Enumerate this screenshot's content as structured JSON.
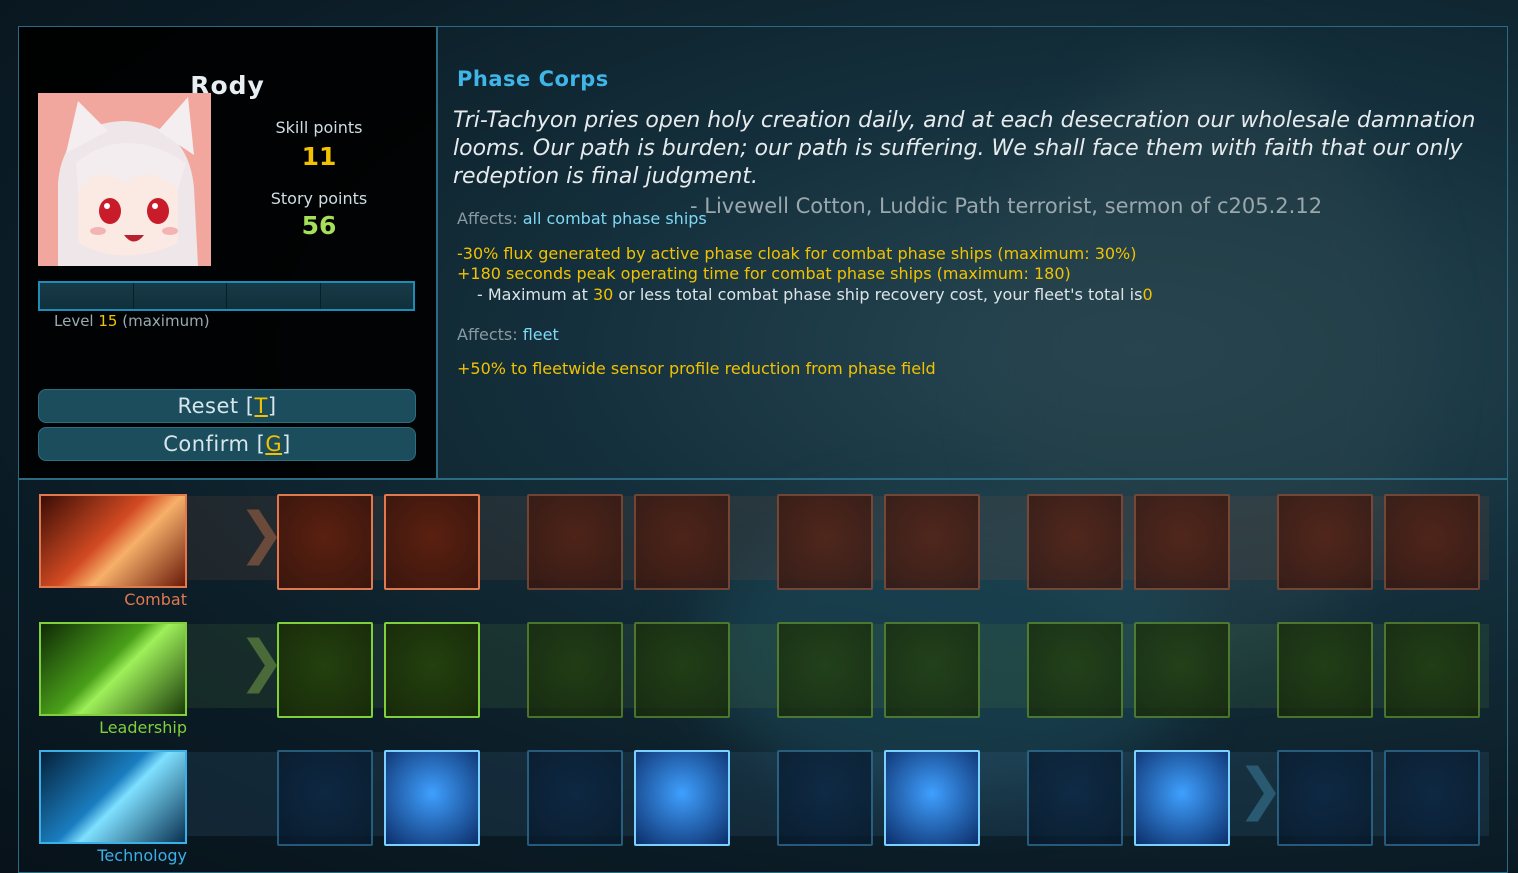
{
  "character": {
    "name": "Rody",
    "skill_points_label": "Skill points",
    "skill_points": "11",
    "story_points_label": "Story points",
    "story_points": "56",
    "level_label": "Level",
    "level_value": "15",
    "level_suffix": "(maximum)",
    "xp_fraction": 1.0
  },
  "buttons": {
    "reset_text": "Reset [",
    "reset_key": "T",
    "confirm_text": "Confirm [",
    "confirm_key": "G",
    "close_bracket": "]"
  },
  "skill_info": {
    "title": "Phase Corps",
    "quote": "Tri-Tachyon pries open holy creation daily, and at each desecration our wholesale damnation looms. Our path is burden; our path is suffering. We shall face them with faith that our only redeption is final judgment.",
    "attribution": "- Livewell Cotton, Luddic Path terrorist, sermon of c205.2.12",
    "affects_label": "Affects:",
    "affects_1": "all combat phase ships",
    "effect_1": "-30% flux generated by active phase cloak for combat phase ships (maximum: 30%)",
    "effect_2": "+180 seconds peak operating time for combat phase ships (maximum: 180)",
    "effect_2_sub_prefix": "- Maximum at",
    "effect_2_sub_val1": "30",
    "effect_2_sub_mid": "or less total combat phase ship recovery cost, your fleet's total is",
    "effect_2_sub_val2": "0",
    "affects_2": "fleet",
    "effect_3": "+50% to fleetwide sensor profile reduction from phase field"
  },
  "aptitudes": [
    {
      "label": "Combat",
      "color": "#e0794e"
    },
    {
      "label": "Leadership",
      "color": "#7fd03b"
    },
    {
      "label": "Technology",
      "color": "#3ab0e8"
    }
  ],
  "colors": {
    "accent": "#3fb5e8",
    "highlight": "#f2c200",
    "frame": "#2c6a82"
  }
}
